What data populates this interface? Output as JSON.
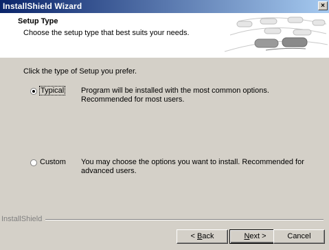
{
  "window": {
    "title": "InstallShield Wizard",
    "close_glyph": "×"
  },
  "header": {
    "title": "Setup Type",
    "subtitle": "Choose the setup type that best suits your needs."
  },
  "prompt": "Click the type of Setup you prefer.",
  "options": [
    {
      "label": "Typical",
      "selected": true,
      "description": "Program will be installed with the most common options. Recommended for most users."
    },
    {
      "label": "Custom",
      "selected": false,
      "description": "You may choose the options you want to install. Recommended for advanced users."
    }
  ],
  "footer": {
    "brand": "InstallShield"
  },
  "buttons": {
    "back": {
      "prefix": "< ",
      "accel": "B",
      "rest": "ack"
    },
    "next": {
      "accel": "N",
      "rest": "ext >"
    },
    "cancel": "Cancel"
  }
}
